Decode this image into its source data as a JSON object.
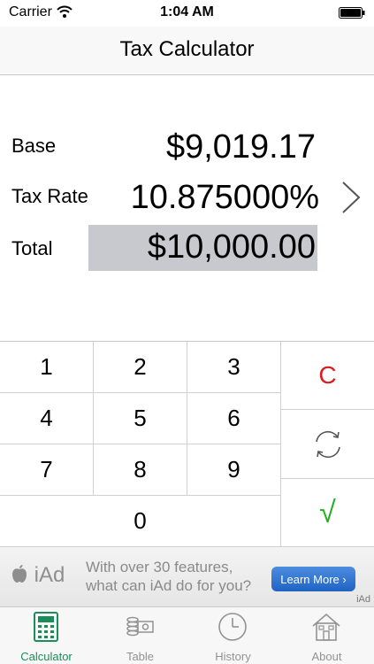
{
  "status_bar": {
    "carrier": "Carrier",
    "time": "1:04 AM"
  },
  "nav": {
    "title": "Tax Calculator"
  },
  "fields": {
    "base": {
      "label": "Base",
      "value": "$9,019.17"
    },
    "tax_rate": {
      "label": "Tax Rate",
      "value": "10.875000%"
    },
    "total": {
      "label": "Total",
      "value": "$10,000.00"
    }
  },
  "keypad": {
    "k1": "1",
    "k2": "2",
    "k3": "3",
    "k4": "4",
    "k5": "5",
    "k6": "6",
    "k7": "7",
    "k8": "8",
    "k9": "9",
    "k0": "0",
    "clear": "C",
    "confirm": "√"
  },
  "iad": {
    "logo": "iAd",
    "message": "With over 30 features, what can iAd do for you?",
    "button": "Learn More ›",
    "tag": "iAd"
  },
  "tabs": [
    {
      "label": "Calculator",
      "icon": "calculator-icon",
      "active": true
    },
    {
      "label": "Table",
      "icon": "table-icon",
      "active": false
    },
    {
      "label": "History",
      "icon": "clock-icon",
      "active": false
    },
    {
      "label": "About",
      "icon": "house-icon",
      "active": false
    }
  ],
  "colors": {
    "accent": "#1c8c5a",
    "clear_key": "#d81e1e",
    "confirm_key": "#22b022",
    "total_highlight": "#c8c8cf",
    "learn_more_button": "#2a6fd0"
  }
}
